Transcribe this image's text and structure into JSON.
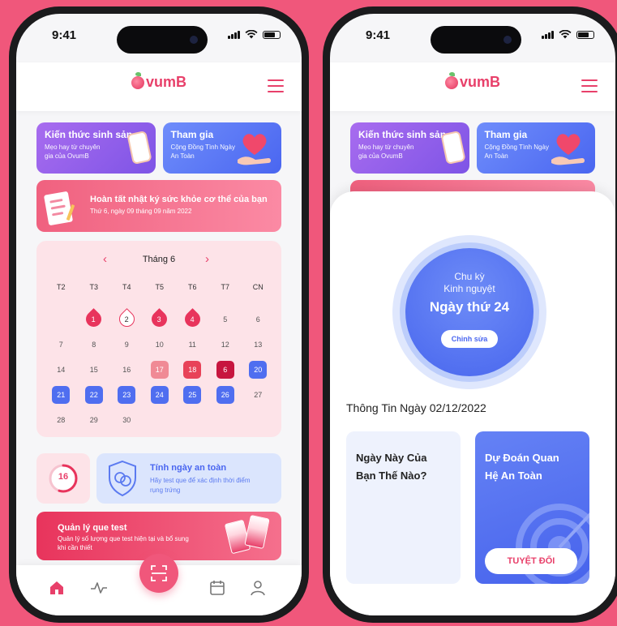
{
  "colors": {
    "background": "#f0577b",
    "primary": "#e8406a",
    "blue": "#4a66f0",
    "purple": "#8f5ce9"
  },
  "left_phone": {
    "status": {
      "time": "9:41"
    },
    "header": {
      "logo_text": "vumB",
      "menu_icon": "hamburger-icon"
    },
    "promos": [
      {
        "title": "Kiến thức sinh sản",
        "subtitle": "Mẹo hay từ chuyên gia của OvumB"
      },
      {
        "title": "Tham gia",
        "subtitle": "Cộng Đồng Tình Ngày An Toàn"
      }
    ],
    "diary": {
      "title": "Hoàn tất nhật ký sức khỏe cơ thể của bạn",
      "subtitle": "Thứ 6, ngày 09 tháng 09 năm 2022"
    },
    "calendar": {
      "month_label": "Tháng 6",
      "prev_icon": "‹",
      "next_icon": "›",
      "weekdays": [
        "T2",
        "T3",
        "T4",
        "T5",
        "T6",
        "T7",
        "CN"
      ],
      "days": [
        {
          "n": "",
          "s": ""
        },
        {
          "n": "1",
          "s": "period"
        },
        {
          "n": "2",
          "s": "drop-outline"
        },
        {
          "n": "3",
          "s": "period"
        },
        {
          "n": "4",
          "s": "period"
        },
        {
          "n": "5",
          "s": ""
        },
        {
          "n": "6",
          "s": ""
        },
        {
          "n": "7",
          "s": ""
        },
        {
          "n": "8",
          "s": ""
        },
        {
          "n": "9",
          "s": ""
        },
        {
          "n": "10",
          "s": ""
        },
        {
          "n": "11",
          "s": ""
        },
        {
          "n": "12",
          "s": ""
        },
        {
          "n": "13",
          "s": ""
        },
        {
          "n": "14",
          "s": ""
        },
        {
          "n": "15",
          "s": ""
        },
        {
          "n": "16",
          "s": ""
        },
        {
          "n": "17",
          "s": "pink"
        },
        {
          "n": "18",
          "s": "red"
        },
        {
          "n": "6",
          "s": "dark"
        },
        {
          "n": "20",
          "s": "blue"
        },
        {
          "n": "21",
          "s": "blue"
        },
        {
          "n": "22",
          "s": "blue"
        },
        {
          "n": "23",
          "s": "blue"
        },
        {
          "n": "24",
          "s": "blue"
        },
        {
          "n": "25",
          "s": "blue"
        },
        {
          "n": "26",
          "s": "blue"
        },
        {
          "n": "27",
          "s": ""
        },
        {
          "n": "28",
          "s": ""
        },
        {
          "n": "29",
          "s": ""
        },
        {
          "n": "30",
          "s": ""
        }
      ]
    },
    "counter": {
      "value": "16",
      "progress": 0.55
    },
    "safe_day": {
      "title": "Tính ngày an toàn",
      "subtitle": "Hãy test que để xác định thời điểm rụng trứng"
    },
    "kits": {
      "title": "Quản lý que test",
      "subtitle": "Quản lý số lượng que test hiện tại và bổ sung khi cần thiết"
    },
    "tabbar": [
      "home-icon",
      "activity-icon",
      "scan-icon",
      "calendar-icon",
      "profile-icon"
    ]
  },
  "right_phone": {
    "status": {
      "time": "9:41"
    },
    "cycle": {
      "line1": "Chu kỳ",
      "line2": "Kinh nguyệt",
      "day_label": "Ngày thứ 24",
      "edit_label": "Chỉnh sửa"
    },
    "info_title": "Thông Tin Ngày 02/12/2022",
    "card_left": {
      "title": "Ngày Này Của Bạn Thế Nào?"
    },
    "card_right": {
      "title": "Dự Đoán Quan Hệ An Toàn",
      "button": "TUYỆT ĐỐI"
    }
  }
}
